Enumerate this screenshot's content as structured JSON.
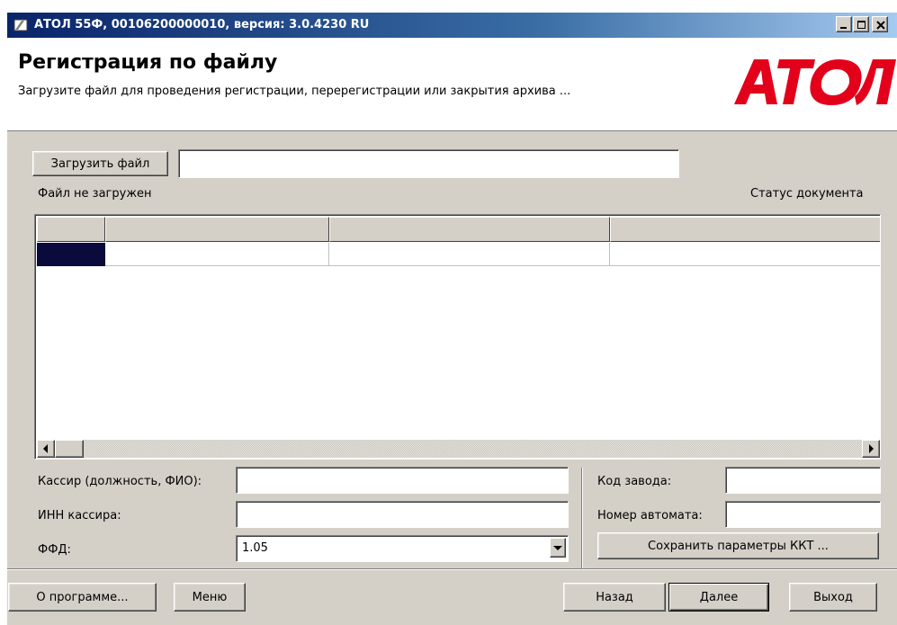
{
  "window": {
    "title": "АТОЛ 55Ф, 00106200000010, версия: 3.0.4230 RU"
  },
  "header": {
    "title": "Регистрация по файлу",
    "subtitle": "Загрузите файл для проведения регистрации, перерегистрации или закрытия архива ...",
    "logo_text": "АТОЛ",
    "logo_color": "#e3001b"
  },
  "file": {
    "load_button": "Загрузить файл",
    "path_value": "",
    "status": "Файл не загружен",
    "document_status_label": "Статус документа"
  },
  "form": {
    "cashier_label": "Кассир (должность, ФИО):",
    "cashier_value": "",
    "inn_label": "ИНН кассира:",
    "inn_value": "",
    "ffd_label": "ФФД:",
    "ffd_value": "1.05",
    "factory_code_label": "Код завода:",
    "factory_code_value": "",
    "machine_number_label": "Номер автомата:",
    "machine_number_value": "",
    "save_params_button": "Сохранить параметры ККТ ..."
  },
  "footer": {
    "about_button": "О программе...",
    "menu_button": "Меню",
    "back_button": "Назад",
    "next_button": "Далее",
    "exit_button": "Выход"
  }
}
